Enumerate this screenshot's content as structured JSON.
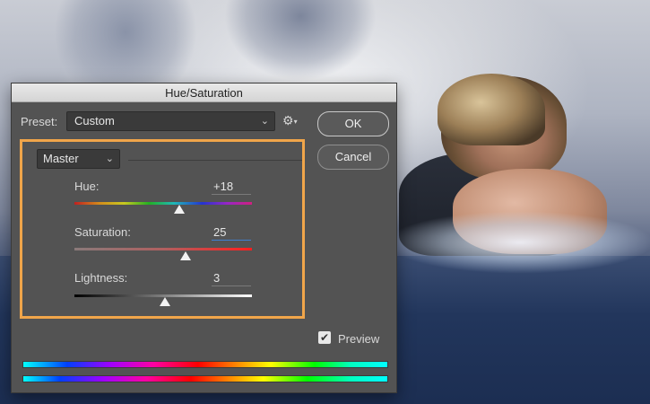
{
  "dialog": {
    "title": "Hue/Saturation",
    "preset_label": "Preset:",
    "preset_value": "Custom",
    "ok_label": "OK",
    "cancel_label": "Cancel",
    "channel_value": "Master",
    "preview_label": "Preview",
    "preview_checked": true
  },
  "sliders": {
    "hue": {
      "label": "Hue:",
      "value": "+18",
      "fraction": 0.59
    },
    "saturation": {
      "label": "Saturation:",
      "value": "25",
      "fraction": 0.625
    },
    "lightness": {
      "label": "Lightness:",
      "value": "3",
      "fraction": 0.51
    }
  },
  "colors": {
    "highlight": "#f0a54a",
    "dialog_bg": "#535353",
    "button_border": "#c9c9c9"
  },
  "icons": [
    "gear-icon",
    "chevron-down-icon",
    "checkmark-icon"
  ]
}
